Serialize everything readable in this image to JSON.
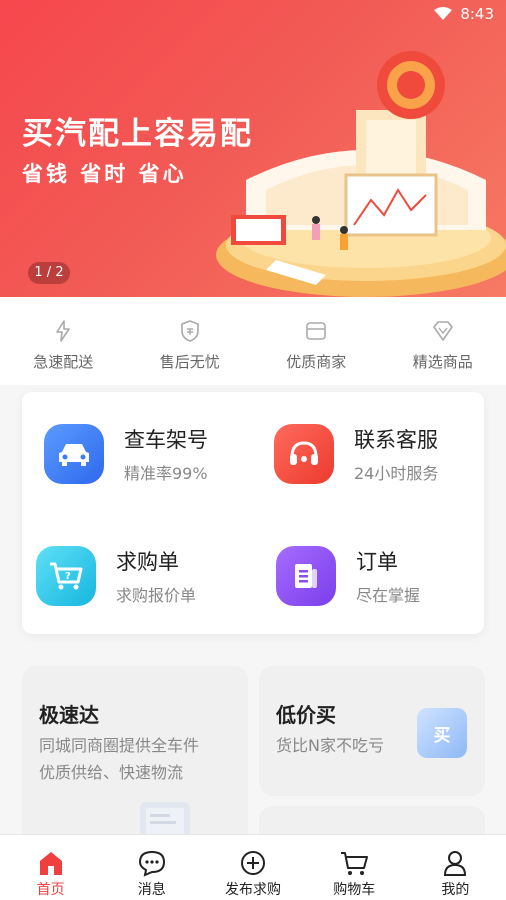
{
  "status_bar": {
    "time": "8:43"
  },
  "banner": {
    "title": "买汽配上容易配",
    "subtitle": "省钱 省时 省心",
    "pager": "1 / 2"
  },
  "features": [
    {
      "label": "急速配送",
      "icon": "lightning-icon"
    },
    {
      "label": "售后无忧",
      "icon": "shield-icon"
    },
    {
      "label": "优质商家",
      "icon": "store-icon"
    },
    {
      "label": "精选商品",
      "icon": "diamond-heart-icon"
    }
  ],
  "services": [
    {
      "title": "查车架号",
      "desc": "精准率99%",
      "icon": "car-icon",
      "color": "#3d7cf5"
    },
    {
      "title": "联系客服",
      "desc": "24小时服务",
      "icon": "headset-icon",
      "color": "#f4433a"
    },
    {
      "title": "求购单",
      "desc": "求购报价单",
      "icon": "cart-question-icon",
      "color": "#22c6e8"
    },
    {
      "title": "订单",
      "desc": "尽在掌握",
      "icon": "document-icon",
      "color": "#8a4df2"
    }
  ],
  "cards": {
    "express": {
      "title": "极速达",
      "desc1": "同城同商圈提供全车件",
      "desc2": "优质供给、快速物流"
    },
    "low_price": {
      "title": "低价买",
      "desc": "货比N家不吃亏",
      "badge": "买"
    }
  },
  "tabbar": [
    {
      "label": "首页",
      "icon": "home-icon",
      "active": true
    },
    {
      "label": "消息",
      "icon": "message-icon",
      "active": false
    },
    {
      "label": "发布求购",
      "icon": "plus-circle-icon",
      "active": false
    },
    {
      "label": "购物车",
      "icon": "cart-icon",
      "active": false
    },
    {
      "label": "我的",
      "icon": "user-icon",
      "active": false
    }
  ],
  "colors": {
    "brand": "#f03f3f",
    "card_bg": "#f0f0f0"
  }
}
